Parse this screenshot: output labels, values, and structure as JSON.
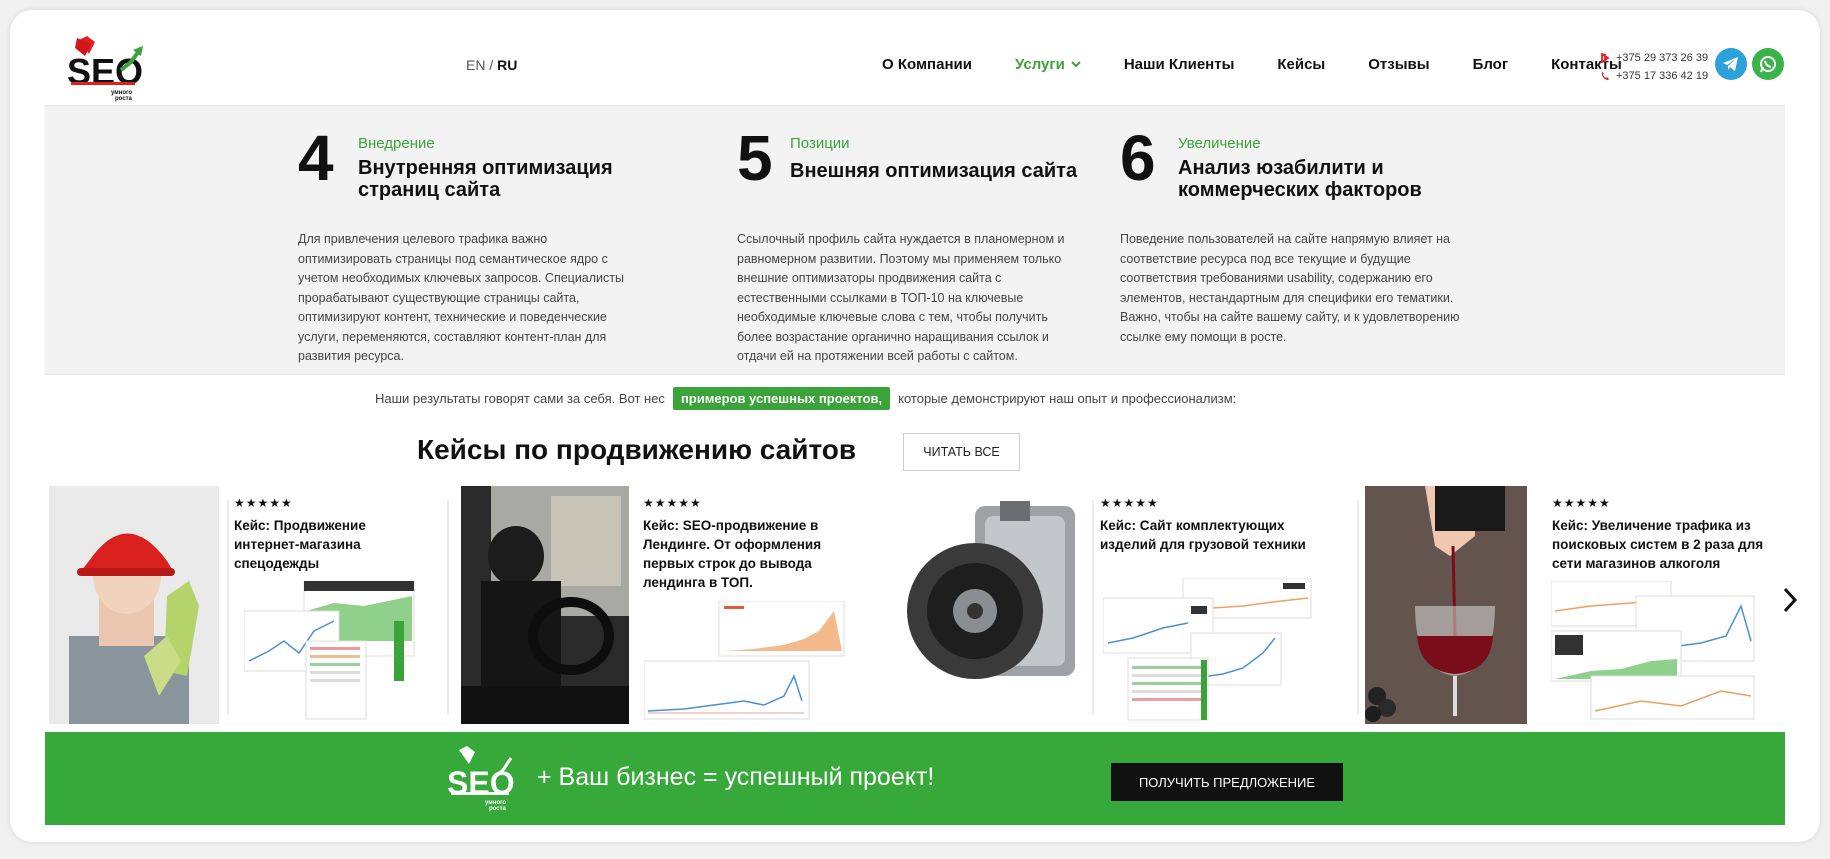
{
  "header": {
    "lang": {
      "en": "EN",
      "sep": "/",
      "ru": "RU"
    },
    "nav": [
      {
        "label": "О Компании"
      },
      {
        "label": "Услуги"
      },
      {
        "label": "Наши Клиенты"
      },
      {
        "label": "Кейсы"
      },
      {
        "label": "Отзывы"
      },
      {
        "label": "Блог"
      },
      {
        "label": "Контакты"
      }
    ],
    "phones": [
      "+375 29 373 26 39",
      "+375 17 336 42 19"
    ],
    "icons": {
      "telegram": "telegram-icon",
      "whatsapp": "whatsapp-icon"
    },
    "colors": {
      "accent": "#3aa43a",
      "telegram": "#2ba2d9",
      "whatsapp": "#3ab34a"
    }
  },
  "steps": [
    {
      "num": "4",
      "kicker": "Внедрение",
      "title_l1": "Внутренняя оптимизация",
      "title_l2": "страниц сайта",
      "desc_lines": [
        "Для привлечения целевого трафика важно",
        "оптимизировать страницы под семантическое ядро с",
        "учетом необходимых ключевых запросов. Специалисты",
        "прорабатывают существующие страницы сайта,",
        "оптимизируют контент, технические и поведенческие",
        "услуги, переменяются, составляют контент-план для",
        "развития ресурса."
      ]
    },
    {
      "num": "5",
      "kicker": "Позиции",
      "title_l1": "Внешняя оптимизация сайта",
      "title_l2": "",
      "desc_lines": [
        "Ссылочный профиль сайта нуждается в планомерном и",
        "равномерном развитии. Поэтому мы применяем только",
        "внешние оптимизаторы продвижения сайта с",
        "естественными ссылками в ТОП-10 на ключевые",
        "необходимые ключевые слова с тем, чтобы получить",
        "более возрастание органично наращивания ссылок и",
        "отдачи ей на протяжении всей работы с сайтом."
      ]
    },
    {
      "num": "6",
      "kicker": "Увеличение",
      "title_l1": "Анализ юзабилити и",
      "title_l2": "коммерческих факторов",
      "desc_lines": [
        "Поведение пользователей на сайте напрямую влияет на",
        "соответствие ресурса под все текущие и будущие",
        "соответствия требованиями usability, содержанию его",
        "элементов, нестандартным для специфики его тематики.",
        "Важно, чтобы на сайте вашему сайту, и к удовлетворению",
        "ссылке ему помощи в росте."
      ]
    }
  ],
  "results": {
    "before": "Наши результаты говорят сами за себя. Вот нес",
    "highlight": "примеров успешных проектов,",
    "after": "которые демонстрируют наш опыт и профессионализм:"
  },
  "cases": {
    "title": "Кейсы по продвижению сайтов",
    "read_all": "ЧИТАТЬ ВСЕ",
    "items": [
      {
        "stars": "★★★★★",
        "title_lines": [
          "Кейс: Продвижение",
          "интернет-магазина",
          "спецодежды"
        ]
      },
      {
        "stars": "★★★★★",
        "title_lines": [
          "Кейс: SEO-продвижение в",
          "Лендинге. От оформления",
          "первых строк до вывода",
          "лендинга в ТОП."
        ]
      },
      {
        "stars": "★★★★★",
        "title_lines": [
          "Кейс: Сайт комплектующих",
          "изделий для грузовой техники"
        ]
      },
      {
        "stars": "★★★★★",
        "title_lines": [
          "Кейс: Увеличение трафика из",
          "поисковых систем в 2 раза для",
          "сети магазинов алкоголя"
        ]
      }
    ]
  },
  "cta": {
    "slogan": "+ Ваш бизнес = успешный проект!",
    "button": "ПОЛУЧИТЬ ПРЕДЛОЖЕНИЕ",
    "color": "#36a93a"
  }
}
